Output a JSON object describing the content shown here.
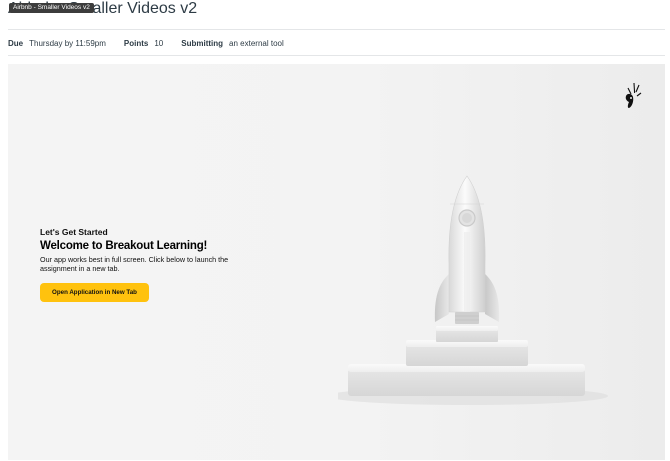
{
  "header": {
    "title": "Airbnb - Smaller Videos v2",
    "tooltip": "Airbnb - Smaller Videos v2"
  },
  "meta": {
    "due_label": "Due",
    "due_value": "Thursday by 11:59pm",
    "points_label": "Points",
    "points_value": "10",
    "submitting_label": "Submitting",
    "submitting_value": "an external tool"
  },
  "tool": {
    "kicker": "Let's Get Started",
    "heading": "Welcome to Breakout Learning!",
    "body": "Our app works best in full screen. Click below to launch the assignment in a new tab.",
    "button_label": "Open Application in New Tab",
    "logo_icon": "breakout-learning-logo-icon",
    "hero_icon": "rocket-on-podium-icon"
  },
  "colors": {
    "accent": "#ffc20e",
    "text": "#2d3b45"
  }
}
